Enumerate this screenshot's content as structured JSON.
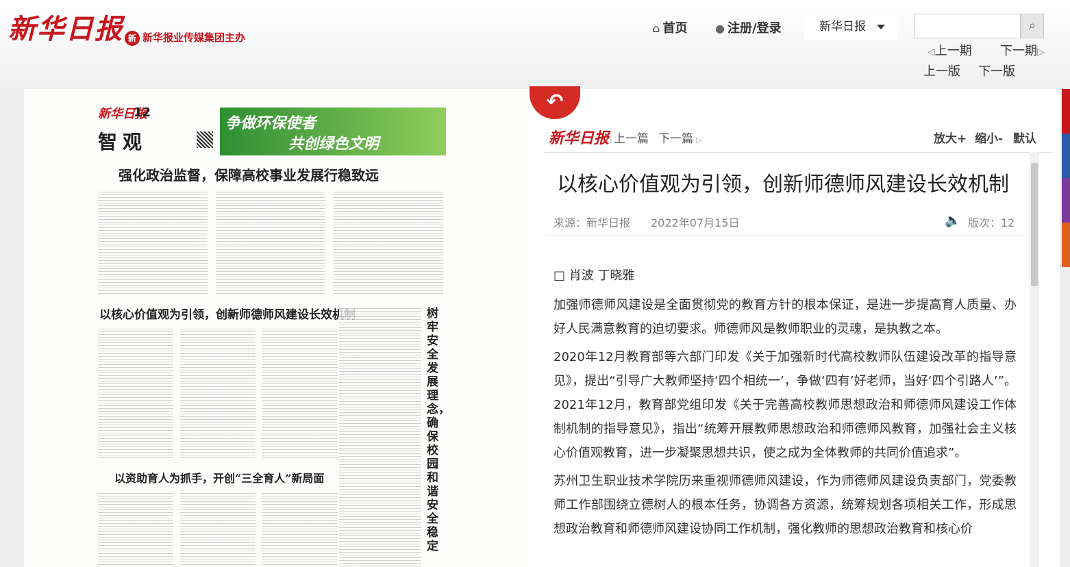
{
  "header": {
    "logo_text": "新华日报",
    "sub_logo_badge": "新",
    "sub_logo_text": "新华报业传媒集团主办",
    "nav": {
      "home": "首页",
      "login": "注册/登录"
    },
    "paper_select": "新华日报",
    "search_placeholder": "",
    "period_prev": "上一期",
    "period_next": "下一期",
    "edition_prev": "上一版",
    "edition_next": "下一版"
  },
  "page_image": {
    "masthead": "新华日报",
    "page_number": "12",
    "section": "智观",
    "banner_line1": "争做环保使者",
    "banner_line2": "共创绿色文明",
    "headline1": "强化政治监督，保障高校事业发展行稳致远",
    "headline2": "以核心价值观为引领，创新师德师风建设长效机制",
    "headline3": "以资助育人为抓手，开创“三全育人”新局面",
    "vertical_headline": "树牢安全发展理念，确保校园和谐安全稳定"
  },
  "reader": {
    "logo": "新华日报",
    "prev_article": "上一篇",
    "next_article": "下一篇",
    "zoom_in": "放大+",
    "zoom_out": "缩小-",
    "zoom_default": "默认",
    "title": "以核心价值观为引领，创新师德师风建设长效机制",
    "source": "来源：新华日报",
    "date": "2022年07月15日",
    "page": "版次：12",
    "author": "□ 肖波 丁晓雅",
    "paragraphs": [
      "加强师德师风建设是全面贯彻党的教育方针的根本保证，是进一步提高育人质量、办好人民满意教育的迫切要求。师德师风是教师职业的灵魂，是执教之本。",
      "2020年12月教育部等六部门印发《关于加强新时代高校教师队伍建设改革的指导意见》，提出“引导广大教师坚持‘四个相统一’，争做‘四有’好老师，当好‘四个引路人’”。2021年12月，教育部党组印发《关于完善高校教师思想政治和师德师风建设工作体制机制的指导意见》，指出“统筹开展教师思想政治和师德师风教育，加强社会主义核心价值观教育，进一步凝聚思想共识，使之成为全体教师的共同价值追求”。",
      "苏州卫生职业技术学院历来重视师德师风建设，作为师德师风建设负责部门，党委教师工作部围绕立德树人的根本任务，协调各方资源，统筹规划各项相关工作，形成思想政治教育和师德师风建设协同工作机制，强化教师的思想政治教育和核心价"
    ]
  },
  "colors": {
    "brand_red": "#c8161d",
    "sideband": [
      "#c8161d",
      "#2a5aa8",
      "#7b3aa0",
      "#e0601f"
    ]
  }
}
